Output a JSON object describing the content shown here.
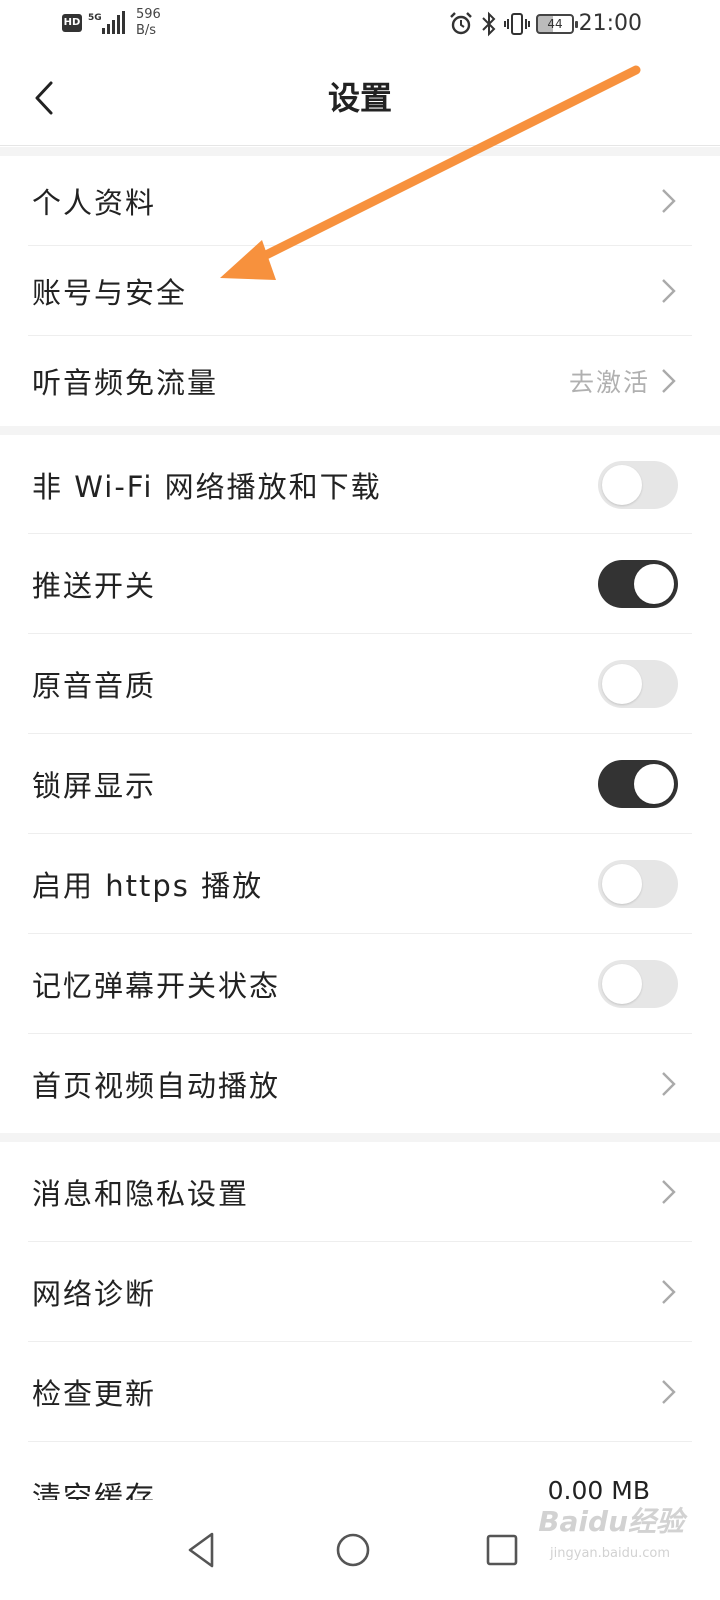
{
  "status_bar": {
    "hd": "HD",
    "network": "5G",
    "speed_value": "596",
    "speed_unit": "B/s",
    "battery": "44",
    "time": "21:00"
  },
  "header": {
    "title": "设置"
  },
  "sections": {
    "profile": {
      "label": "个人资料"
    },
    "account": {
      "label": "账号与安全"
    },
    "audio_free": {
      "label": "听音频免流量",
      "value": "去激活"
    },
    "non_wifi": {
      "label": "非 Wi-Fi 网络播放和下载",
      "on": false
    },
    "push": {
      "label": "推送开关",
      "on": true
    },
    "original_sound": {
      "label": "原音音质",
      "on": false
    },
    "lock_screen": {
      "label": "锁屏显示",
      "on": true
    },
    "https": {
      "label": "启用 https 播放",
      "on": false
    },
    "danmaku": {
      "label": "记忆弹幕开关状态",
      "on": false
    },
    "autoplay": {
      "label": "首页视频自动播放"
    },
    "privacy": {
      "label": "消息和隐私设置"
    },
    "diagnose": {
      "label": "网络诊断"
    },
    "update": {
      "label": "检查更新"
    },
    "cache": {
      "label": "清空缓存",
      "value": "0.00 MB"
    }
  },
  "watermark": {
    "brand": "Baidu经验",
    "url": "jingyan.baidu.com"
  },
  "colors": {
    "annotation_arrow": "#f7913d",
    "toggle_on": "#333333",
    "toggle_off": "#e6e6e6"
  },
  "icons": [
    "back-arrow-icon",
    "chevron-right-icon",
    "alarm-icon",
    "bluetooth-icon",
    "vibrate-icon",
    "battery-icon",
    "nav-back-icon",
    "nav-home-icon",
    "nav-recents-icon"
  ]
}
